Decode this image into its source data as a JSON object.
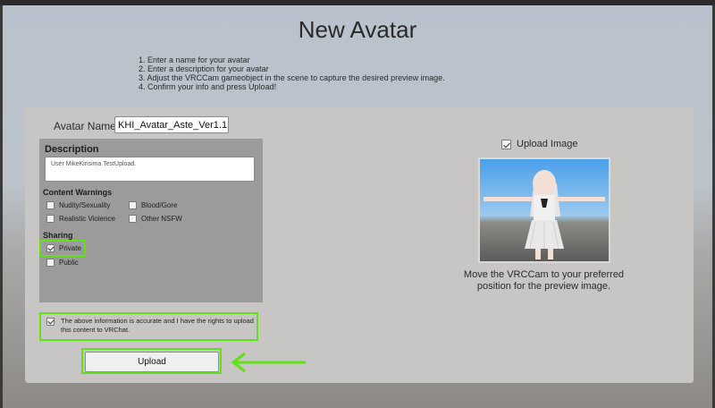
{
  "window": {
    "title": "New Avatar"
  },
  "instructions": [
    "1. Enter a name for your avatar",
    "2. Enter a description for your avatar",
    "3. Adjust the VRCCam gameobject in the scene to capture the desired preview image.",
    "4. Confirm your info and press Upload!"
  ],
  "form": {
    "name_label": "Avatar Name",
    "name_value": "KHI_Avatar_Aste_Ver1.1",
    "description_title": "Description",
    "description_value": "User MikeKirisima TestUpload.",
    "content_warnings_title": "Content Warnings",
    "content_warnings": [
      {
        "label": "Nudity/Sexuality",
        "checked": false
      },
      {
        "label": "Blood/Gore",
        "checked": false
      },
      {
        "label": "Realistic Violence",
        "checked": false
      },
      {
        "label": "Other NSFW",
        "checked": false
      }
    ],
    "sharing_title": "Sharing",
    "sharing": [
      {
        "label": "Private",
        "checked": true
      },
      {
        "label": "Public",
        "checked": false
      }
    ],
    "rights_text": "The above information is accurate and I have the rights to upload this content to VRChat.",
    "rights_checked": true,
    "upload_label": "Upload"
  },
  "preview": {
    "upload_image_label": "Upload Image",
    "upload_image_checked": true,
    "caption": "Move the VRCCam to your preferred position for the preview image."
  },
  "colors": {
    "highlight": "#62e01a"
  }
}
